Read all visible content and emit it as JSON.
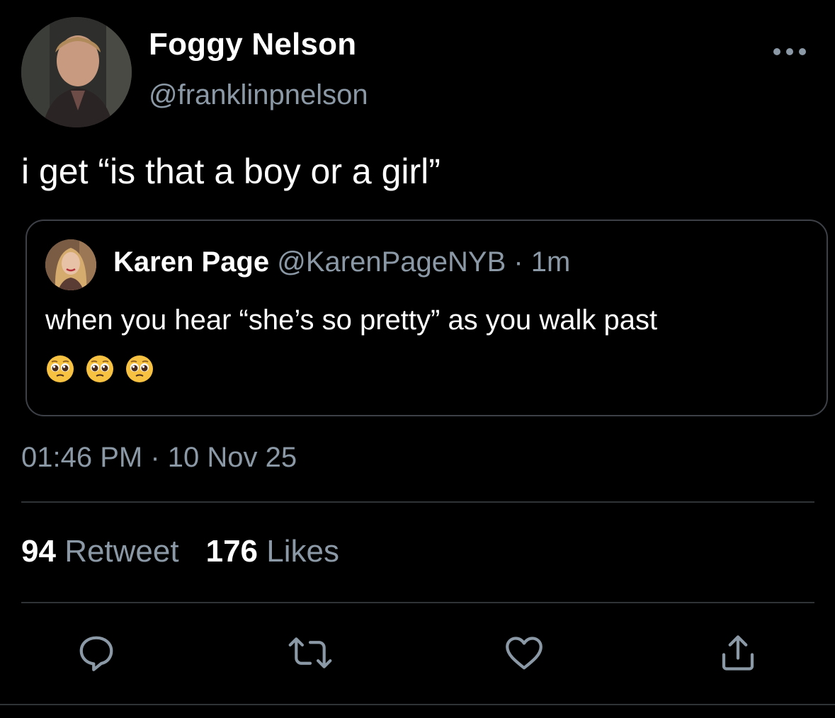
{
  "tweet": {
    "author": {
      "display_name": "Foggy Nelson",
      "handle": "@franklinpnelson"
    },
    "text": "i get “is that a boy or a girl”",
    "quoted": {
      "display_name": "Karen Page",
      "handle": "@KarenPageNYB",
      "separator": " · ",
      "age": "1m",
      "text": "when you hear “she’s so pretty” as you walk past",
      "emojis": [
        "pleading-face",
        "pleading-face",
        "pleading-face"
      ]
    },
    "timestamp": "01:46 PM · 10 Nov 25",
    "stats": {
      "retweets_count": "94",
      "retweets_label": "Retweet",
      "likes_count": "176",
      "likes_label": "Likes"
    }
  },
  "actions": {
    "icons": [
      "reply-icon",
      "retweet-icon",
      "like-icon",
      "share-icon"
    ]
  },
  "colors": {
    "background": "#000000",
    "primary_text": "#ffffff",
    "secondary_text": "#8b98a5",
    "border": "#3d4147",
    "divider": "#2f3336"
  }
}
